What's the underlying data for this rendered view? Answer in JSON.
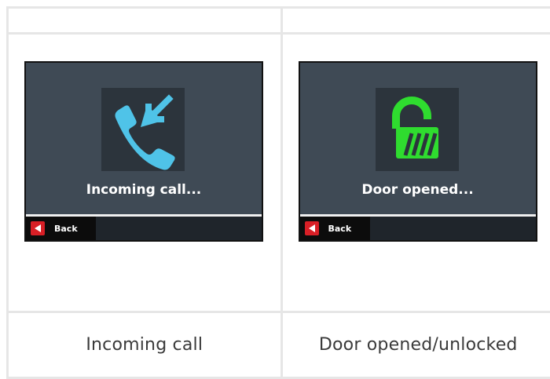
{
  "screens": [
    {
      "message": "Incoming call...",
      "icon": "incoming-call-icon",
      "icon_color": "#4fc3e8",
      "back_label": "Back",
      "caption": "Incoming call"
    },
    {
      "message": "Door opened...",
      "icon": "unlocked-padlock-icon",
      "icon_color": "#2fdc2f",
      "back_label": "Back",
      "caption": "Door opened/unlocked"
    }
  ],
  "colors": {
    "screen_bg": "#3f4a55",
    "icon_tile_bg": "#2c343c",
    "back_button_red": "#d81f26",
    "table_border": "#e6e6e6"
  }
}
